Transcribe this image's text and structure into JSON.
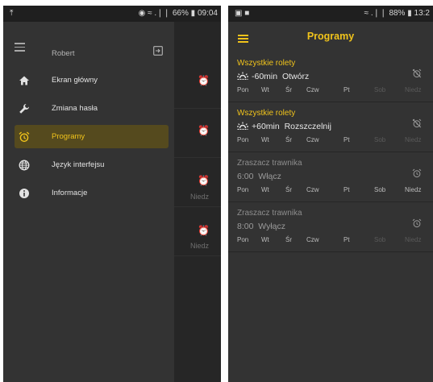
{
  "left_phone": {
    "status_bar": {
      "left_icon": "upload-icon",
      "left_text": "↥",
      "right_text": "☸ ☷ .∣∣ 66% ▮ 09:04",
      "time": "09:04",
      "battery": "66%"
    },
    "drawer": {
      "user_name": "Robert",
      "menu": [
        {
          "label": "Ekran główny",
          "icon": "home-icon",
          "active": false
        },
        {
          "label": "Zmiana hasła",
          "icon": "wrench-icon",
          "active": false
        },
        {
          "label": "Programy",
          "icon": "alarm-clock-icon",
          "active": true
        },
        {
          "label": "Język interfejsu",
          "icon": "globe-icon",
          "active": false
        },
        {
          "label": "Informacje",
          "icon": "info-icon",
          "active": false
        }
      ]
    },
    "background_days": [
      "Niedz",
      "Niedz"
    ]
  },
  "right_phone": {
    "status_bar": {
      "time": "13:2",
      "battery": "88%"
    },
    "title": "Programy",
    "programs": [
      {
        "name": "Wszystkie rolety",
        "offset": "-60min",
        "action": "Otwórz",
        "sun_icon": true,
        "active": true,
        "days": [
          "Pon",
          "Wt",
          "Śr",
          "Czw",
          "Pt",
          "Sob",
          "Niedz"
        ],
        "days_enabled": [
          true,
          true,
          true,
          true,
          true,
          false,
          false
        ]
      },
      {
        "name": "Wszystkie rolety",
        "offset": "+60min",
        "action": "Rozszczelnij",
        "sun_icon": true,
        "active": true,
        "days": [
          "Pon",
          "Wt",
          "Śr",
          "Czw",
          "Pt",
          "Sob",
          "Niedz"
        ],
        "days_enabled": [
          true,
          true,
          true,
          true,
          true,
          false,
          false
        ]
      },
      {
        "name": "Zraszacz trawnika",
        "offset": "6:00",
        "action": "Włącz",
        "sun_icon": false,
        "active": false,
        "days": [
          "Pon",
          "Wt",
          "Śr",
          "Czw",
          "Pt",
          "Sob",
          "Niedz"
        ],
        "days_enabled": [
          true,
          true,
          true,
          true,
          true,
          true,
          true
        ]
      },
      {
        "name": "Zraszacz trawnika",
        "offset": "8:00",
        "action": "Wyłącz",
        "sun_icon": false,
        "active": false,
        "days": [
          "Pon",
          "Wt",
          "Śr",
          "Czw",
          "Pt",
          "Sob",
          "Niedz"
        ],
        "days_enabled": [
          true,
          true,
          true,
          true,
          true,
          false,
          false
        ]
      }
    ]
  },
  "colors": {
    "accent": "#f0c31b",
    "background": "#333333",
    "active_item_bg": "#554a1e",
    "disabled_day": "#5a5a5a",
    "enabled_day": "#bcbcbc"
  }
}
